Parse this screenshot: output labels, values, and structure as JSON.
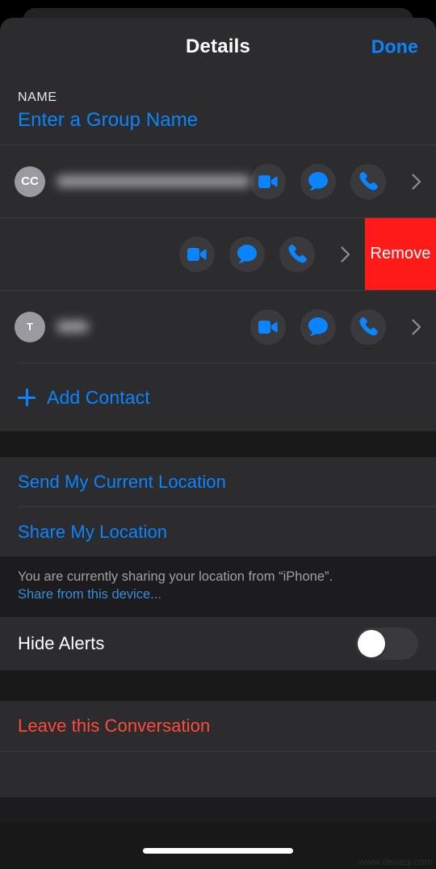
{
  "nav": {
    "title": "Details",
    "done_label": "Done"
  },
  "name_section": {
    "label": "NAME",
    "placeholder": "Enter a Group Name",
    "value": ""
  },
  "contacts": {
    "row_actions": {
      "video_icon": "video-camera-icon",
      "message_icon": "message-bubble-icon",
      "phone_icon": "phone-handset-icon",
      "disclosure_icon": "chevron-right-icon"
    },
    "items": [
      {
        "initials": "CC",
        "name": "",
        "name_hidden": true,
        "name_width": 250,
        "has_avatar": true,
        "swiped": false,
        "remove_label": "Remove"
      },
      {
        "initials": "",
        "name": "",
        "name_hidden": true,
        "name_width": 56,
        "has_avatar": false,
        "swiped": true,
        "remove_label": "Remove"
      },
      {
        "initials": "T",
        "name": "",
        "name_hidden": true,
        "name_width": 40,
        "has_avatar": true,
        "swiped": false,
        "remove_label": "Remove"
      }
    ],
    "add_contact_label": "Add Contact",
    "add_icon": "plus-icon"
  },
  "location": {
    "send_current_label": "Send My Current Location",
    "share_label": "Share My Location",
    "footnote_text": "You are currently sharing your location from “iPhone”.",
    "footnote_link": "Share from this device..."
  },
  "alerts": {
    "hide_alerts_label": "Hide Alerts",
    "hide_alerts_on": false
  },
  "danger": {
    "leave_label": "Leave this Conversation"
  },
  "watermark": {
    "text": "www.deuaq.com"
  },
  "colors": {
    "accent_blue": "#0a84ff",
    "destructive_red": "#ff4a3d",
    "remove_red": "#ff1a1a",
    "row_background": "#2c2c2e",
    "sheet_background": "#1c1c1e",
    "avatar_gray": "#9a9aa0",
    "action_button_gray": "#3a3a3c"
  }
}
